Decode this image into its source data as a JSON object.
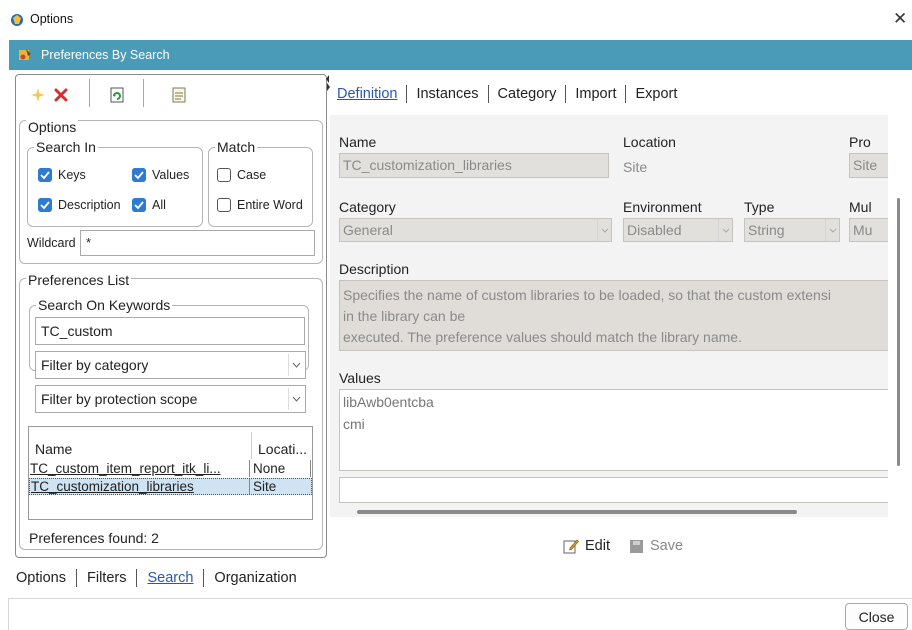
{
  "window": {
    "title": "Options",
    "banner_title": "Preferences By Search"
  },
  "options": {
    "legend": "Options",
    "search_in": {
      "legend": "Search In",
      "keys": {
        "label": "Keys",
        "checked": true
      },
      "values": {
        "label": "Values",
        "checked": true
      },
      "description": {
        "label": "Description",
        "checked": true
      },
      "all": {
        "label": "All",
        "checked": true
      }
    },
    "match": {
      "legend": "Match",
      "case": {
        "label": "Case",
        "checked": false
      },
      "entire_word": {
        "label": "Entire Word",
        "checked": false
      }
    },
    "wildcard": {
      "label": "Wildcard",
      "value": "*"
    }
  },
  "preferences_list": {
    "legend": "Preferences List",
    "search_on_keywords": {
      "legend": "Search On Keywords",
      "value": "TC_custom"
    },
    "filter_category": "Filter by category",
    "filter_scope": "Filter by protection scope",
    "columns": {
      "name": "Name",
      "location": "Locati..."
    },
    "rows": [
      {
        "name": "TC_custom_item_report_itk_li...",
        "location": "None",
        "selected": false
      },
      {
        "name": "TC_customization_libraries",
        "location": "Site",
        "selected": true
      }
    ],
    "found": "Preferences found: 2"
  },
  "bottom_tabs": [
    {
      "label": "Options",
      "active": false
    },
    {
      "label": "Filters",
      "active": false
    },
    {
      "label": "Search",
      "active": true
    },
    {
      "label": "Organization",
      "active": false
    }
  ],
  "right_tabs": [
    {
      "label": "Definition",
      "active": true
    },
    {
      "label": "Instances",
      "active": false
    },
    {
      "label": "Category",
      "active": false
    },
    {
      "label": "Import",
      "active": false
    },
    {
      "label": "Export",
      "active": false
    }
  ],
  "definition": {
    "name": {
      "label": "Name",
      "value": "TC_customization_libraries"
    },
    "location": {
      "label": "Location",
      "value": "Site"
    },
    "protection": {
      "label": "Pro",
      "value": "Site"
    },
    "category": {
      "label": "Category",
      "value": "General"
    },
    "environment": {
      "label": "Environment",
      "value": "Disabled"
    },
    "type": {
      "label": "Type",
      "value": "String"
    },
    "multiple": {
      "label": "Mul",
      "value": "Mu"
    },
    "description": {
      "label": "Description",
      "lines": [
        "Specifies the name of custom libraries to be loaded, so that the custom extensi",
        "in the library can be",
        "executed. The preference values should match the library name."
      ]
    },
    "values": {
      "label": "Values",
      "items": [
        "libAwb0entcba",
        "cmi"
      ]
    }
  },
  "actions": {
    "edit": "Edit",
    "save": "Save",
    "close": "Close"
  },
  "colors": {
    "banner": "#4a9bb8",
    "checkbox": "#2e7bcf",
    "link": "#2a5aa7",
    "selected_row": "#cfe3f2"
  }
}
